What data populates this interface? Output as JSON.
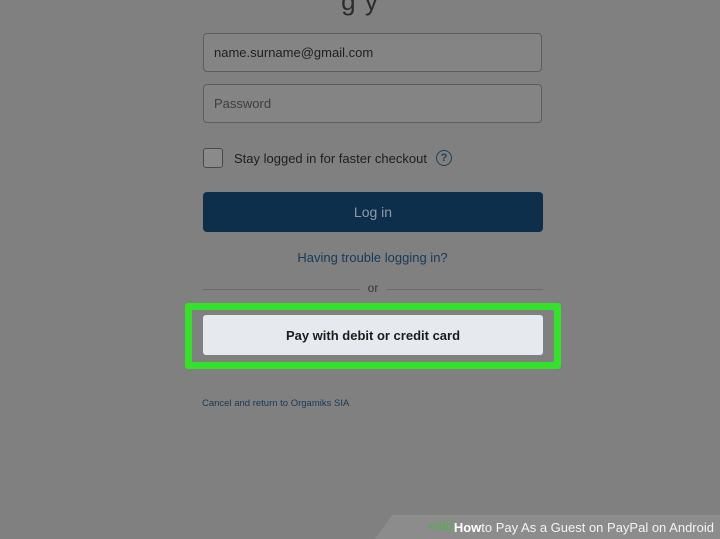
{
  "header": {
    "partial_title": "g    y"
  },
  "login_form": {
    "email_value": "name.surname@gmail.com",
    "password_placeholder": "Password",
    "stay_logged_in_label": "Stay logged in for faster checkout",
    "help_symbol": "?",
    "login_label": "Log in",
    "trouble_link": "Having trouble logging in?",
    "divider_text": "or",
    "card_button_label": "Pay with debit or credit card",
    "cancel_link": "Cancel and return to Orgamiks SIA"
  },
  "watermark": {
    "brand": "wiki",
    "how": "How",
    "title_rest": " to Pay As a Guest on PayPal on Android"
  },
  "colors": {
    "login_button": "#0d2f4c",
    "highlight": "#35e22b",
    "background": "#808080"
  }
}
